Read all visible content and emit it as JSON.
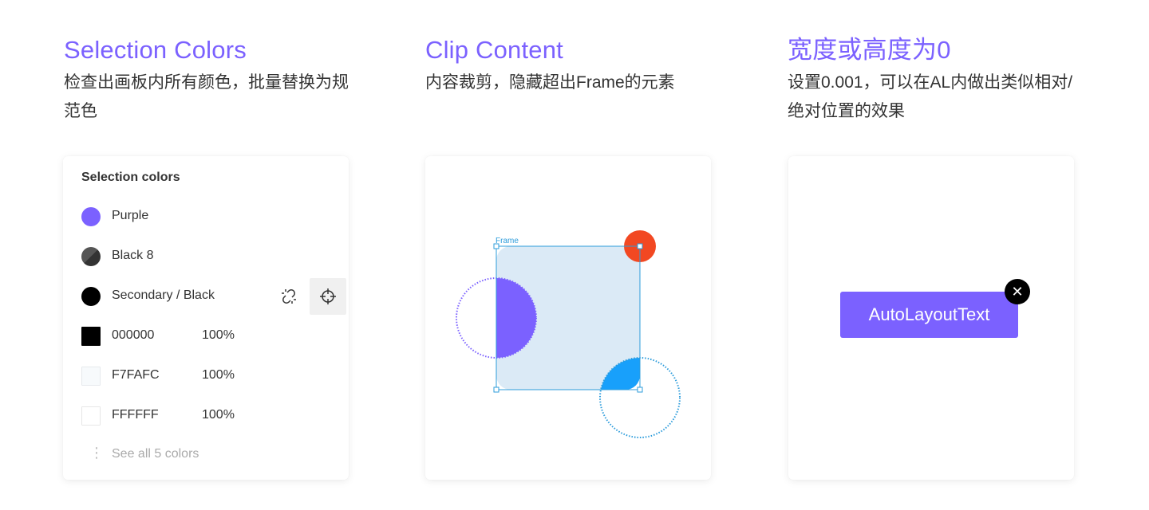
{
  "columns": [
    {
      "title": "Selection Colors",
      "description": "检查出画板内所有颜色，批量替换为规范色"
    },
    {
      "title": "Clip Content",
      "description": "内容裁剪，隐藏超出Frame的元素"
    },
    {
      "title": "宽度或高度为0",
      "description": "设置0.001，可以在AL内做出类似相对/绝对位置的效果"
    }
  ],
  "selection_panel": {
    "title": "Selection colors",
    "styles": [
      {
        "label": "Purple",
        "color": "#7B61FF"
      },
      {
        "label": "Black 8",
        "color": "#333333"
      },
      {
        "label": "Secondary / Black",
        "color": "#000000"
      }
    ],
    "colors": [
      {
        "hex": "000000",
        "opacity": "100%",
        "color": "#000000"
      },
      {
        "hex": "F7FAFC",
        "opacity": "100%",
        "color": "#F7FAFC"
      },
      {
        "hex": "FFFFFF",
        "opacity": "100%",
        "color": "#FFFFFF"
      }
    ],
    "see_all": "See all 5 colors",
    "icons": {
      "detach": "detach-link-icon",
      "select": "target-icon"
    }
  },
  "clip_demo": {
    "frame_label": "Frame",
    "colors": {
      "frame_fill": "#DBEAF6",
      "frame_stroke": "#2D9CDB",
      "purple": "#7B61FF",
      "blue": "#18A0FB",
      "red": "#F24822"
    }
  },
  "autolayout_demo": {
    "text": "AutoLayoutText",
    "close_glyph": "✕",
    "accent": "#7B61FF"
  }
}
